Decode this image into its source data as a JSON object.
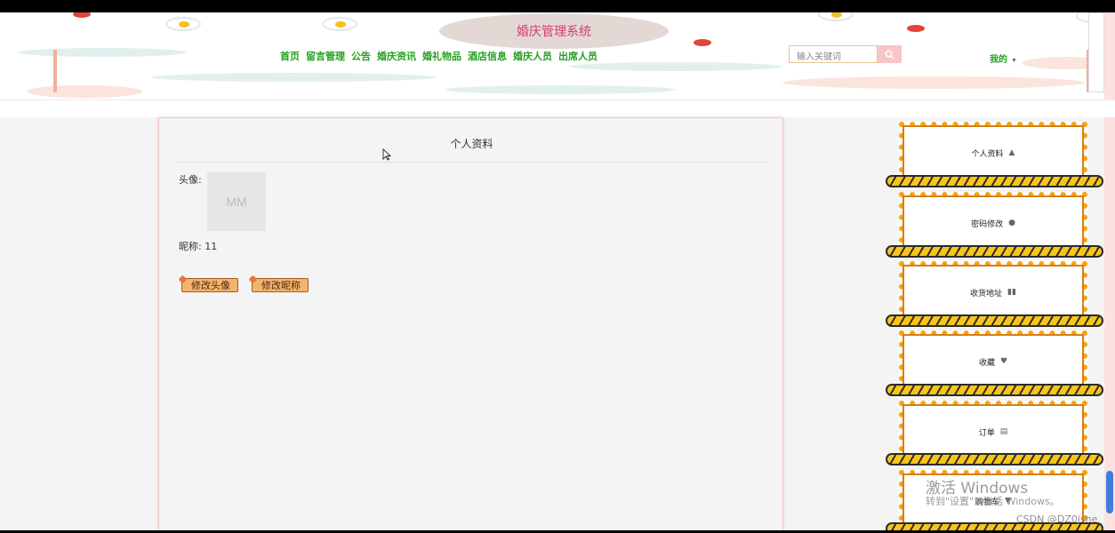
{
  "header": {
    "system_title": "婚庆管理系统",
    "nav": [
      "首页",
      "留言管理",
      "公告",
      "婚庆资讯",
      "婚礼物品",
      "酒店信息",
      "婚庆人员",
      "出席人员"
    ],
    "search_placeholder": "输入关键词",
    "search_icon": "search-icon",
    "user_menu": "我的",
    "user_caret": "▼"
  },
  "profile": {
    "title": "个人资料",
    "avatar_label": "头像:",
    "avatar_text": "MM",
    "nickname_label": "昵称: 11",
    "btn_change_avatar": "修改头像",
    "btn_change_nickname": "修改昵称"
  },
  "sidebar": {
    "items": [
      {
        "label": "个人资料",
        "icon": "home-icon",
        "glyph": "▲"
      },
      {
        "label": "密码修改",
        "icon": "user-icon",
        "glyph": "●"
      },
      {
        "label": "收货地址",
        "icon": "barcode-icon",
        "glyph": "▮▮"
      },
      {
        "label": "收藏",
        "icon": "heart-icon",
        "glyph": "♥"
      },
      {
        "label": "订单",
        "icon": "file-icon",
        "glyph": "▤"
      },
      {
        "label": "购物车",
        "icon": "cart-icon",
        "glyph": "▼"
      }
    ]
  },
  "overlay": {
    "watermark_line1": "激活 Windows",
    "watermark_line2": "转到\"设置\"以激活 Windows。",
    "csdn": "CSDN @DZ0jshe"
  },
  "colors": {
    "nav_green": "#23a11e",
    "title_pink": "#d03d73",
    "frame_orange": "#f7a313"
  }
}
